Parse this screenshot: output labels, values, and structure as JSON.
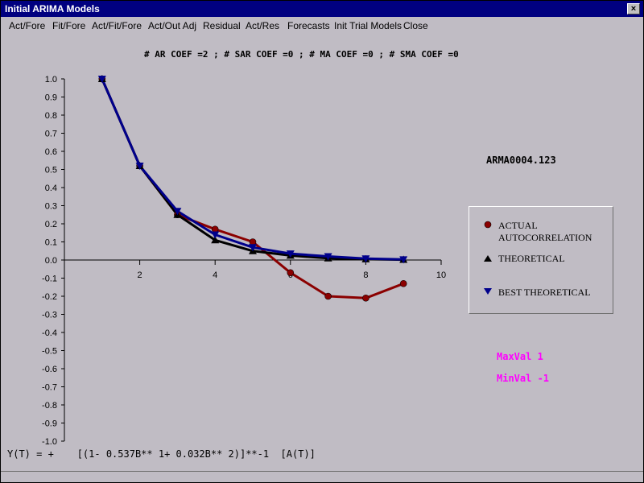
{
  "window": {
    "title": "Initial ARIMA Models",
    "close_glyph": "×"
  },
  "menu": [
    "Act/Fore",
    "Fit/Fore",
    "Act/Fit/Fore",
    "Act/Out Adj",
    "Residual",
    "Act/Res",
    "Forecasts",
    "Init Trial Models",
    "Close"
  ],
  "header": {
    "coef_line": "# AR COEF =2 ; # SAR COEF =0 ; # MA COEF =0 ; # SMA COEF =0"
  },
  "series_name": "ARMA0004.123",
  "maxval": "MaxVal 1",
  "minval": "MinVal -1",
  "equation": "Y(T) = +    [(1- 0.537B** 1+ 0.032B** 2)]**-1  [A(T)]",
  "legend": {
    "actual_line1": "ACTUAL",
    "actual_line2": "AUTOCORRELATION",
    "theoretical": "THEORETICAL",
    "best": "BEST THEORETICAL"
  },
  "colors": {
    "actual": "#8b0000",
    "theoretical": "#000000",
    "best": "#00008b",
    "minmax": "#ff00ff"
  },
  "chart_data": {
    "type": "line",
    "x": [
      1,
      2,
      3,
      4,
      5,
      6,
      7,
      8,
      9
    ],
    "xlim": [
      0,
      10
    ],
    "ylim": [
      -1,
      1
    ],
    "x_ticks": [
      "2",
      "4",
      "6",
      "8",
      "10"
    ],
    "y_ticks": [
      "1.0",
      "0.9",
      "0.8",
      "0.7",
      "0.6",
      "0.5",
      "0.4",
      "0.3",
      "0.2",
      "0.1",
      "0.0",
      "-0.1",
      "-0.2",
      "-0.3",
      "-0.4",
      "-0.5",
      "-0.6",
      "-0.7",
      "-0.8",
      "-0.9",
      "-1.0"
    ],
    "series": [
      {
        "name": "ACTUAL AUTOCORRELATION",
        "marker": "circle",
        "values": [
          1.0,
          0.52,
          0.25,
          0.17,
          0.1,
          -0.07,
          -0.2,
          -0.21,
          -0.13
        ]
      },
      {
        "name": "THEORETICAL",
        "marker": "triangle-up",
        "values": [
          1.0,
          0.52,
          0.25,
          0.11,
          0.05,
          0.025,
          0.01,
          0.005,
          0.002
        ]
      },
      {
        "name": "BEST THEORETICAL",
        "marker": "triangle-down",
        "values": [
          1.0,
          0.52,
          0.27,
          0.14,
          0.07,
          0.035,
          0.02,
          0.008,
          0.003
        ]
      }
    ]
  }
}
